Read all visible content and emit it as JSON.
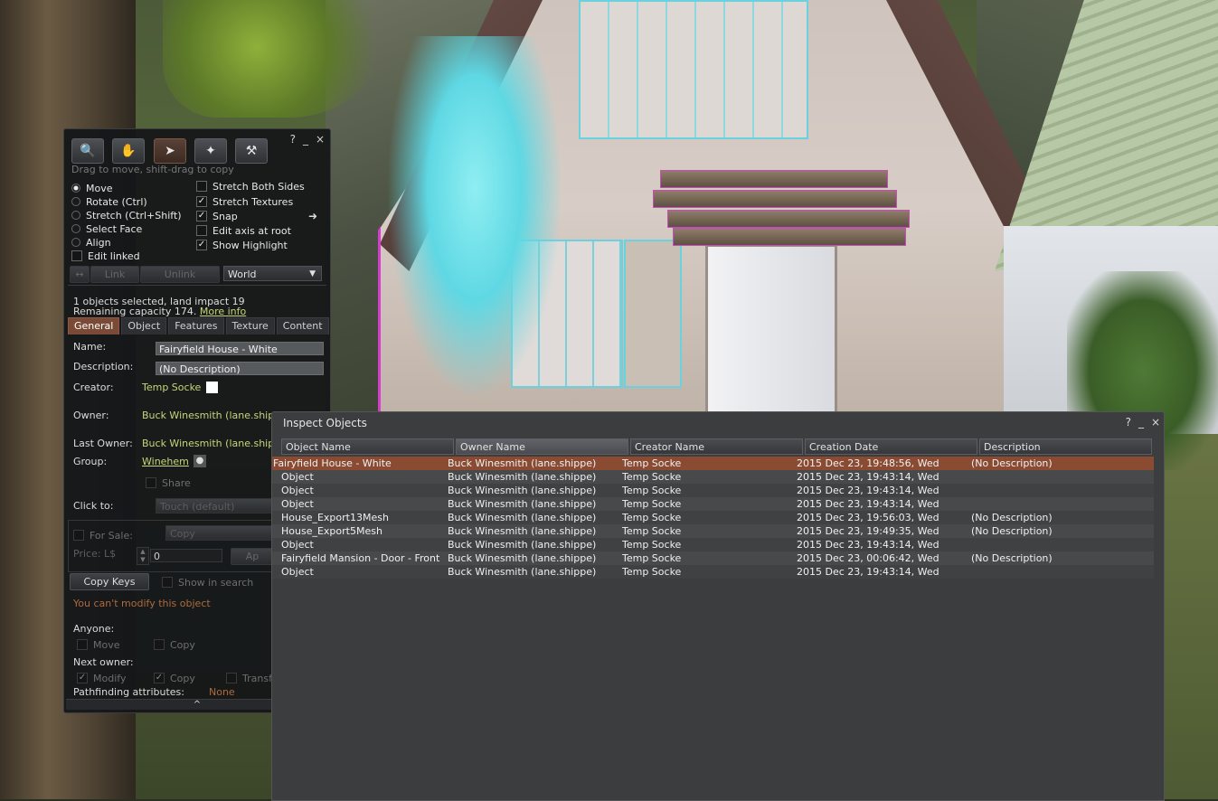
{
  "build": {
    "tools": [
      {
        "name": "focus-tool-button",
        "icon": "magnifier-icon"
      },
      {
        "name": "move-tool-button",
        "icon": "hand-icon"
      },
      {
        "name": "edit-tool-button",
        "icon": "pointer-icon"
      },
      {
        "name": "create-tool-button",
        "icon": "wand-icon"
      },
      {
        "name": "land-tool-button",
        "icon": "bulldozer-icon"
      }
    ],
    "help": "?",
    "minimize": "_",
    "close": "×",
    "hint": "Drag to move, shift-drag to copy",
    "modes": [
      {
        "label": "Move",
        "selected": true
      },
      {
        "label": "Rotate (Ctrl)",
        "selected": false
      },
      {
        "label": "Stretch (Ctrl+Shift)",
        "selected": false
      },
      {
        "label": "Select Face",
        "selected": false
      },
      {
        "label": "Align",
        "selected": false
      }
    ],
    "edit_linked": "Edit linked",
    "options": [
      {
        "label": "Stretch Both Sides",
        "checked": false
      },
      {
        "label": "Stretch Textures",
        "checked": true
      },
      {
        "label": "Snap",
        "checked": true
      },
      {
        "label": "Edit axis at root",
        "checked": false
      },
      {
        "label": "Show Highlight",
        "checked": true
      }
    ],
    "link": "Link",
    "unlink": "Unlink",
    "ruler": "World",
    "selection_info": "1 objects selected, land impact 19",
    "remaining": "Remaining capacity 174.",
    "more_info": "More info",
    "tabs": [
      "General",
      "Object",
      "Features",
      "Texture",
      "Content"
    ],
    "active_tab": "General",
    "name_label": "Name:",
    "name_value": "Fairyfield House - White",
    "desc_label": "Description:",
    "desc_value": "(No Description)",
    "creator_label": "Creator:",
    "creator_value": "Temp Socke",
    "owner_label": "Owner:",
    "owner_value": "Buck Winesmith (lane.shipp",
    "last_owner_label": "Last Owner:",
    "last_owner_value": "Buck Winesmith (lane.shipp",
    "group_label": "Group:",
    "group_value": "Winehem",
    "share": "Share",
    "click_to_label": "Click to:",
    "click_to_value": "Touch  (default)",
    "for_sale": "For Sale:",
    "sale_type": "Copy",
    "price_label": "Price: L$",
    "price_value": "0",
    "apply": "Ap",
    "copy_keys": "Copy Keys",
    "show_in_search": "Show in search",
    "cant_modify": "You can't modify this object",
    "anyone_label": "Anyone:",
    "anyone_move": "Move",
    "anyone_copy": "Copy",
    "next_owner_label": "Next owner:",
    "next_modify": "Modify",
    "next_copy": "Copy",
    "next_transfer": "Transf",
    "pathfinding_label": "Pathfinding attributes:",
    "pathfinding_value": "None",
    "expand": "^"
  },
  "inspect": {
    "title": "Inspect Objects",
    "help": "?",
    "minimize": "_",
    "close": "×",
    "columns": [
      "Object Name",
      "Owner Name",
      "Creator Name",
      "Creation Date",
      "Description"
    ],
    "sorted_column": "Owner Name",
    "rows": [
      {
        "name": "Fairyfield House - White",
        "owner": "Buck Winesmith (lane.shippe)",
        "creator": "Temp Socke",
        "date": "2015 Dec 23, 19:48:56, Wed",
        "desc": "(No Description)"
      },
      {
        "name": "Object",
        "owner": "Buck Winesmith (lane.shippe)",
        "creator": "Temp Socke",
        "date": "2015 Dec 23, 19:43:14, Wed",
        "desc": ""
      },
      {
        "name": "Object",
        "owner": "Buck Winesmith (lane.shippe)",
        "creator": "Temp Socke",
        "date": "2015 Dec 23, 19:43:14, Wed",
        "desc": ""
      },
      {
        "name": "Object",
        "owner": "Buck Winesmith (lane.shippe)",
        "creator": "Temp Socke",
        "date": "2015 Dec 23, 19:43:14, Wed",
        "desc": ""
      },
      {
        "name": "House_Export13Mesh",
        "owner": "Buck Winesmith (lane.shippe)",
        "creator": "Temp Socke",
        "date": "2015 Dec 23, 19:56:03, Wed",
        "desc": "(No Description)"
      },
      {
        "name": "House_Export5Mesh",
        "owner": "Buck Winesmith (lane.shippe)",
        "creator": "Temp Socke",
        "date": "2015 Dec 23, 19:49:35, Wed",
        "desc": "(No Description)"
      },
      {
        "name": "Object",
        "owner": "Buck Winesmith (lane.shippe)",
        "creator": "Temp Socke",
        "date": "2015 Dec 23, 19:43:14, Wed",
        "desc": ""
      },
      {
        "name": "Fairyfield Mansion - Door - Front",
        "owner": "Buck Winesmith (lane.shippe)",
        "creator": "Temp Socke",
        "date": "2015 Dec 23, 00:06:42, Wed",
        "desc": "(No Description)"
      },
      {
        "name": "Object",
        "owner": "Buck Winesmith (lane.shippe)",
        "creator": "Temp Socke",
        "date": "2015 Dec 23, 19:43:14, Wed",
        "desc": ""
      }
    ]
  },
  "colors": {
    "selected_row": "#8b4b33",
    "active_tab": "#7a4a36",
    "link_text": "#c6d67a",
    "object_highlight": "#d53cd0"
  }
}
